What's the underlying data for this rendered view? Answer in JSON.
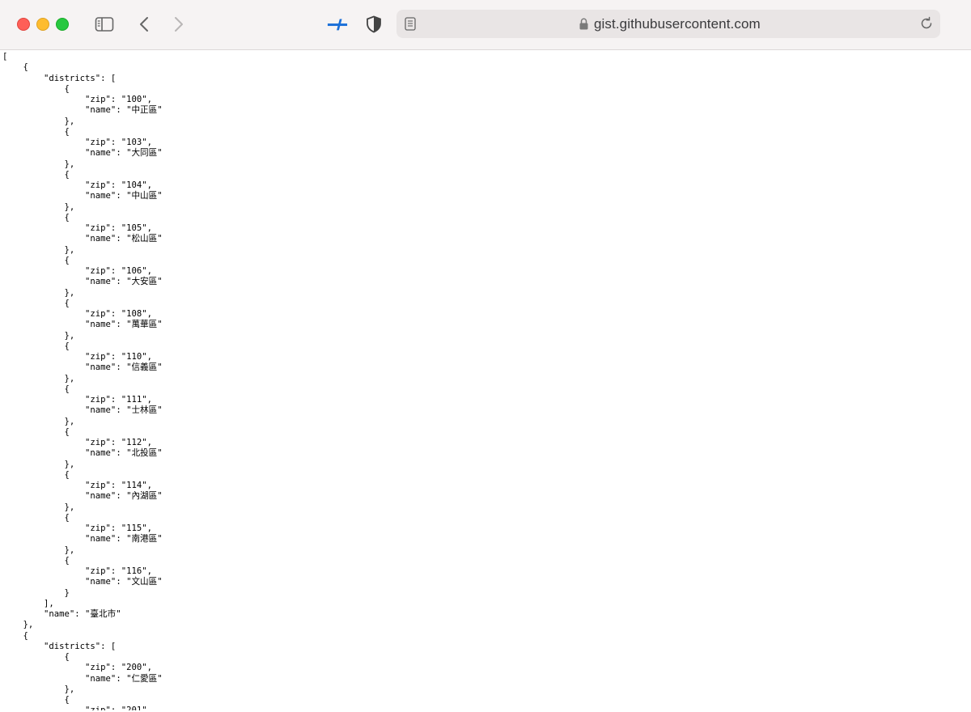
{
  "browser": {
    "url": "gist.githubusercontent.com"
  },
  "icons": {
    "sidebar": "sidebar-icon",
    "back": "chevron-left-icon",
    "forward": "chevron-right-icon",
    "extension": "extension-icon",
    "privacy": "shield-icon",
    "reader": "reader-icon",
    "lock": "lock-icon",
    "reload": "reload-icon"
  },
  "colors": {
    "close": "#fe5f57",
    "minimize": "#febc2e",
    "maximize": "#28c840",
    "toolbar": "#f6f3f3",
    "address_bar": "#e9e5e5",
    "extension_accent": "#1a6fd8"
  },
  "content": {
    "json_text": "[\n    {\n        \"districts\": [\n            {\n                \"zip\": \"100\",\n                \"name\": \"中正區\"\n            },\n            {\n                \"zip\": \"103\",\n                \"name\": \"大同區\"\n            },\n            {\n                \"zip\": \"104\",\n                \"name\": \"中山區\"\n            },\n            {\n                \"zip\": \"105\",\n                \"name\": \"松山區\"\n            },\n            {\n                \"zip\": \"106\",\n                \"name\": \"大安區\"\n            },\n            {\n                \"zip\": \"108\",\n                \"name\": \"萬華區\"\n            },\n            {\n                \"zip\": \"110\",\n                \"name\": \"信義區\"\n            },\n            {\n                \"zip\": \"111\",\n                \"name\": \"士林區\"\n            },\n            {\n                \"zip\": \"112\",\n                \"name\": \"北投區\"\n            },\n            {\n                \"zip\": \"114\",\n                \"name\": \"內湖區\"\n            },\n            {\n                \"zip\": \"115\",\n                \"name\": \"南港區\"\n            },\n            {\n                \"zip\": \"116\",\n                \"name\": \"文山區\"\n            }\n        ],\n        \"name\": \"臺北市\"\n    },\n    {\n        \"districts\": [\n            {\n                \"zip\": \"200\",\n                \"name\": \"仁愛區\"\n            },\n            {\n                \"zip\": \"201\","
  }
}
